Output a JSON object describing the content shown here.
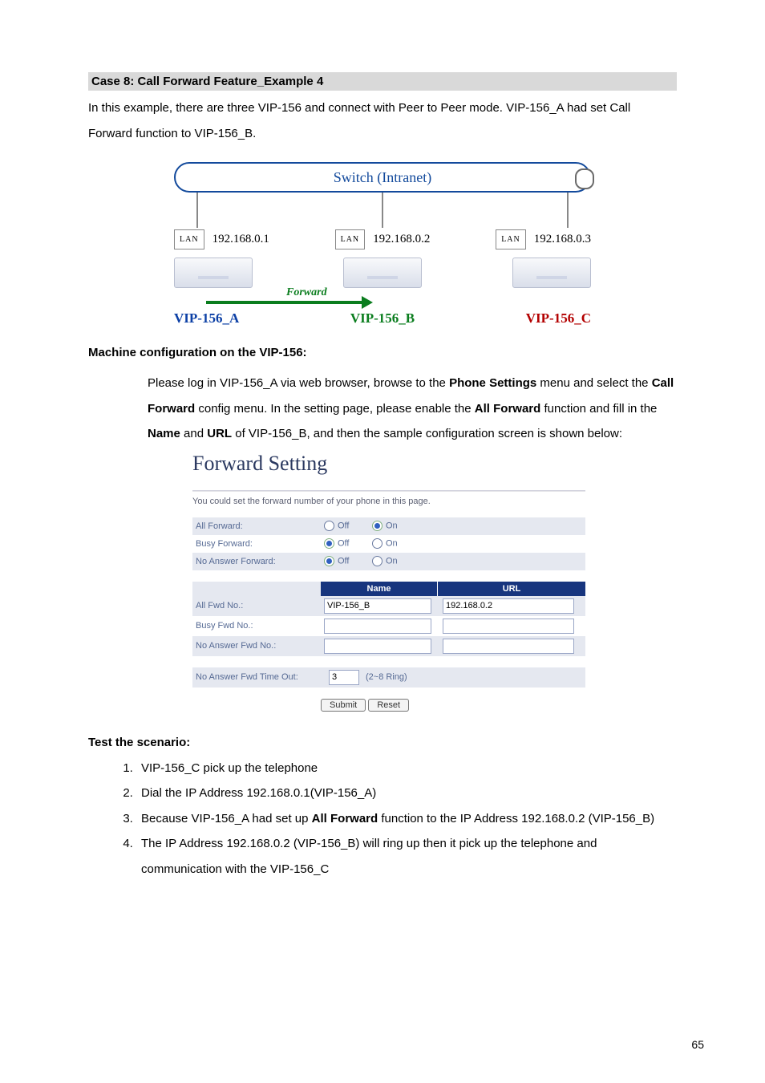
{
  "section_title": "Case 8: Call Forward Feature_Example 4",
  "intro": "In this example, there are three VIP-156 and connect with Peer to Peer mode. VIP-156_A had set Call Forward function to VIP-156_B.",
  "diagram": {
    "switch_label": "Switch (Intranet)",
    "lan_label": "LAN",
    "nodes": [
      {
        "ip": "192.168.0.1",
        "name": "VIP-156_A"
      },
      {
        "ip": "192.168.0.2",
        "name": "VIP-156_B"
      },
      {
        "ip": "192.168.0.3",
        "name": "VIP-156_C"
      }
    ],
    "forward_label": "Forward"
  },
  "machine_cfg_heading": "Machine configuration on the VIP-156:",
  "machine_cfg": {
    "pre1": "Please log in VIP-156_A via web browser, browse to the ",
    "b1": "Phone Settings",
    "mid1": " menu and select the ",
    "b2": "Call Forward",
    "mid2": " config menu. In the setting page, please enable the ",
    "b3": "All Forward",
    "mid3": " function and fill in the ",
    "b4": "Name",
    "mid4": " and ",
    "b5": "URL",
    "tail": " of VIP-156_B, and then the sample configuration screen is shown below:"
  },
  "forward_setting": {
    "title": "Forward Setting",
    "desc": "You could set the forward number of your phone in this page.",
    "rows": [
      {
        "label": "All Forward:",
        "off": "Off",
        "on": "On",
        "selected": "on"
      },
      {
        "label": "Busy Forward:",
        "off": "Off",
        "on": "On",
        "selected": "off"
      },
      {
        "label": "No Answer Forward:",
        "off": "Off",
        "on": "On",
        "selected": "off"
      }
    ],
    "col_name": "Name",
    "col_url": "URL",
    "inputs": [
      {
        "label": "All Fwd No.:",
        "name": "VIP-156_B",
        "url": "192.168.0.2"
      },
      {
        "label": "Busy Fwd No.:",
        "name": "",
        "url": ""
      },
      {
        "label": "No Answer Fwd No.:",
        "name": "",
        "url": ""
      }
    ],
    "timeout_label": "No Answer Fwd Time Out:",
    "timeout_value": "3",
    "timeout_hint": "(2~8 Ring)",
    "submit": "Submit",
    "reset": "Reset"
  },
  "scenario_heading": "Test the scenario:",
  "scenario": {
    "s1": "VIP-156_C pick up the telephone",
    "s2": "Dial the IP Address 192.168.0.1(VIP-156_A)",
    "s3a": "Because VIP-156_A had set up ",
    "s3b": "All Forward",
    "s3c": " function to the IP Address 192.168.0.2 (VIP-156_B)",
    "s4": "The IP Address 192.168.0.2 (VIP-156_B) will ring up then it pick up the telephone and communication with the VIP-156_C"
  },
  "page_number": "65"
}
